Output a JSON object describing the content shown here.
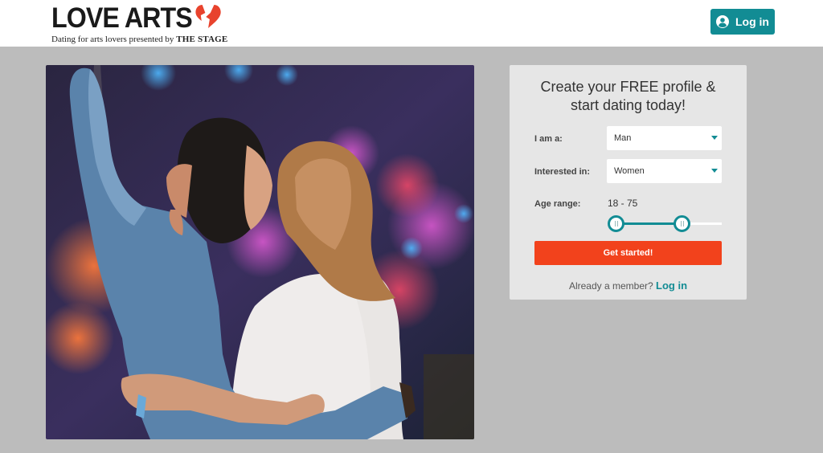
{
  "header": {
    "logo_title": "LOVE ARTS",
    "logo_tagline": "Dating for arts lovers presented by",
    "logo_tagline_brand": "THE STAGE",
    "login_label": "Log in",
    "accent_color": "#128c94",
    "heart_color": "#e8432d"
  },
  "signup": {
    "title_line1": "Create your FREE profile &",
    "title_line2": "start dating today!",
    "iam_label": "I am a:",
    "iam_value": "Man",
    "interested_label": "Interested in:",
    "interested_value": "Women",
    "age_label": "Age range:",
    "age_value": "18 - 75",
    "age_min": 18,
    "age_max": 75,
    "cta_label": "Get started!",
    "cta_color": "#f2421c",
    "member_text": "Already a member?",
    "member_link": "Log in"
  }
}
